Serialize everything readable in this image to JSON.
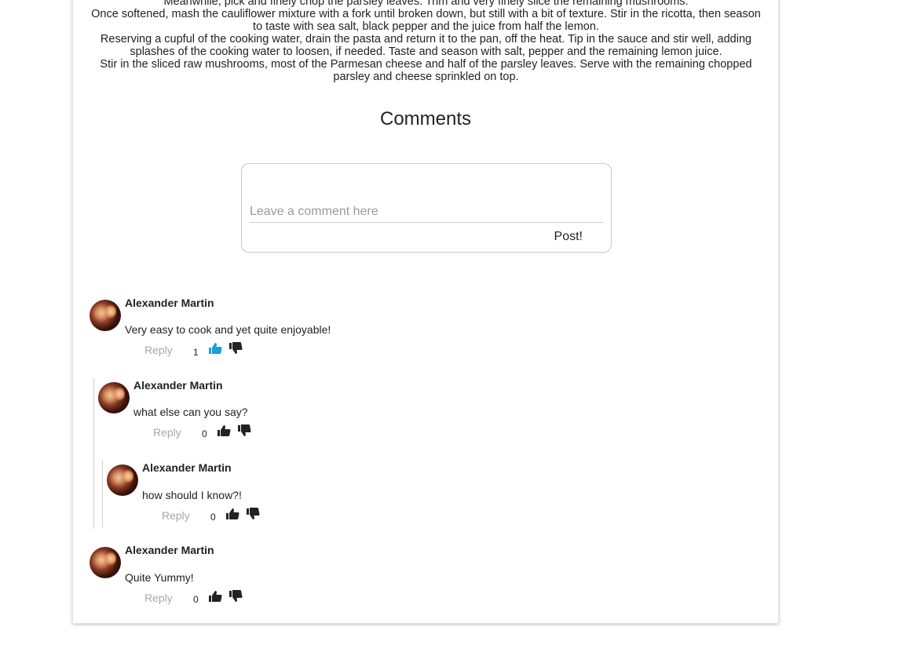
{
  "recipe": {
    "steps": [
      "Meanwhile, pick and finely chop the parsley leaves. Trim and very finely slice the remaining mushrooms.",
      "Once softened, mash the cauliflower mixture with a fork until broken down, but still with a bit of texture. Stir in the ricotta, then season to taste with sea salt, black pepper and the juice from half the lemon.",
      "Reserving a cupful of the cooking water, drain the pasta and return it to the pan, off the heat. Tip in the sauce and stir well, adding splashes of the cooking water to loosen, if needed. Taste and season with salt, pepper and the remaining lemon juice.",
      "Stir in the sliced raw mushrooms, most of the Parmesan cheese and half of the parsley leaves. Serve with the remaining chopped parsley and cheese sprinkled on top."
    ]
  },
  "comments_section": {
    "title": "Comments",
    "input_placeholder": "Leave a comment here",
    "input_value": "",
    "post_label": "Post!"
  },
  "comments": [
    {
      "author": "Alexander Martin",
      "text": "Very easy to cook and yet quite enjoyable!",
      "reply_label": "Reply",
      "votes": "1",
      "liked": true
    },
    {
      "author": "Alexander Martin",
      "text": "what else can you say?",
      "reply_label": "Reply",
      "votes": "0",
      "liked": false
    },
    {
      "author": "Alexander Martin",
      "text": "how should I know?!",
      "reply_label": "Reply",
      "votes": "0",
      "liked": false
    },
    {
      "author": "Alexander Martin",
      "text": "Quite Yummy!",
      "reply_label": "Reply",
      "votes": "0",
      "liked": false
    }
  ],
  "colors": {
    "like_active": "#1a9fd8",
    "icon_default": "#222222",
    "reply_text": "#a8a8a8"
  }
}
